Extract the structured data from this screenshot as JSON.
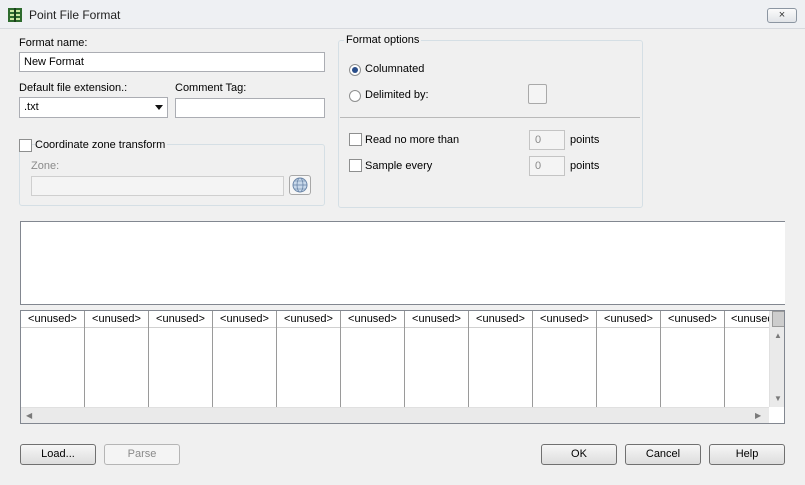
{
  "window": {
    "title": "Point File Format",
    "close_label": "×"
  },
  "format_name": {
    "label": "Format name:",
    "value": "New Format"
  },
  "extension": {
    "label": "Default file extension.:",
    "value": ".txt"
  },
  "comment_tag": {
    "label": "Comment Tag:",
    "value": ""
  },
  "zone_transform": {
    "label": "Coordinate zone transform",
    "checked": false,
    "zone_label": "Zone:",
    "zone_value": ""
  },
  "format_options": {
    "legend": "Format options",
    "columnated_label": "Columnated",
    "columnated_selected": true,
    "delimited_label": "Delimited by:",
    "delimited_selected": false,
    "read_limit_label": "Read no more than",
    "read_limit_value": "0",
    "read_limit_unit": "points",
    "sample_label": "Sample every",
    "sample_value": "0",
    "sample_unit": "points"
  },
  "columns": [
    "<unused>",
    "<unused>",
    "<unused>",
    "<unused>",
    "<unused>",
    "<unused>",
    "<unused>",
    "<unused>",
    "<unused>",
    "<unused>",
    "<unused>",
    "<unused>"
  ],
  "buttons": {
    "load": "Load...",
    "parse": "Parse",
    "ok": "OK",
    "cancel": "Cancel",
    "help": "Help"
  }
}
